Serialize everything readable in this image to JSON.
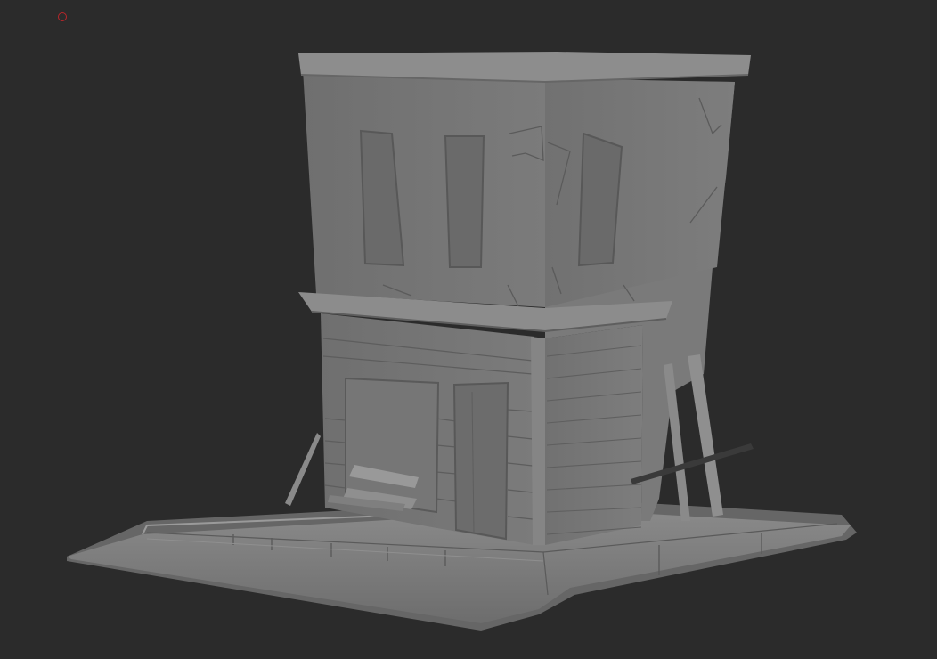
{
  "viewport": {
    "background": "#2b2b2b",
    "pivot_marker_color": "#b8262a",
    "pivot_marker_icon": "circle-outline-icon"
  },
  "scene": {
    "object": "sculpted-building-model",
    "material_color": "#7a7a7a"
  }
}
